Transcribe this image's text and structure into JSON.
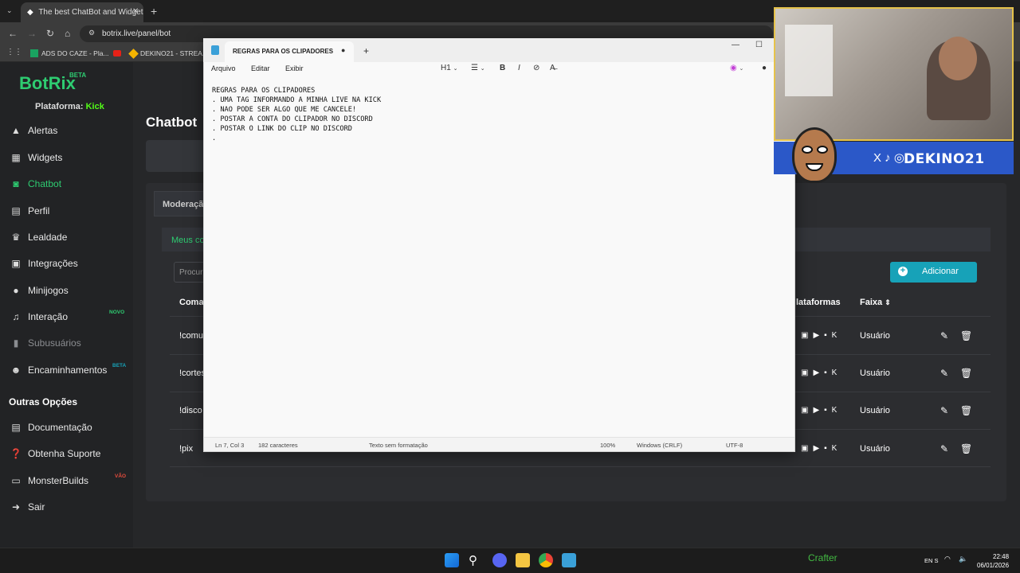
{
  "browser": {
    "tab_title": "The best ChatBot and Widgets",
    "url": "botrix.live/panel/bot",
    "bookmarks": [
      "ADS DO CAZE - Pla...",
      "DEKINO21 - STREA..."
    ]
  },
  "site": {
    "logo": "BotRix",
    "logo_badge": "BETA",
    "platform_label": "Plataforma:",
    "platform_value": "Kick",
    "nav": [
      {
        "label": "Alertas",
        "icon": "alert-icon"
      },
      {
        "label": "Widgets",
        "icon": "grid-icon"
      },
      {
        "label": "Chatbot",
        "icon": "robot-icon"
      },
      {
        "label": "Perfil",
        "icon": "id-card-icon"
      },
      {
        "label": "Lealdade",
        "icon": "trophy-icon"
      },
      {
        "label": "Integrações",
        "icon": "integration-icon"
      },
      {
        "label": "Minijogos",
        "icon": "gamepad-icon"
      },
      {
        "label": "Interação",
        "icon": "music-icon",
        "badge": "NOVO"
      },
      {
        "label": "Subusuários",
        "icon": "lock-icon"
      },
      {
        "label": "Encaminhamentos",
        "icon": "users-icon",
        "badge": "BETA"
      }
    ],
    "other_heading": "Outras Opções",
    "other_nav": [
      {
        "label": "Documentação",
        "icon": "book-icon"
      },
      {
        "label": "Obtenha Suporte",
        "icon": "help-icon"
      },
      {
        "label": "MonsterBuilds",
        "icon": "laptop-icon",
        "badge": "VÃO"
      },
      {
        "label": "Sair",
        "icon": "logout-icon"
      }
    ],
    "page_title": "Chatbot",
    "tab_moderacao": "Moderaçã",
    "subtab": "Meus co",
    "search_placeholder": "Procur",
    "add_button": "Adicionar",
    "columns": {
      "command": "Comar",
      "platforms": "lataformas",
      "tier": "Faixa"
    },
    "rows": [
      {
        "command": "!comu",
        "tier": "Usuário"
      },
      {
        "command": "!cortes",
        "tier": "Usuário"
      },
      {
        "command": "!disco",
        "tier": "Usuário"
      },
      {
        "command": "!pix",
        "tier": "Usuário"
      }
    ]
  },
  "notepad": {
    "tab_title": "REGRAS PARA OS CLIPADORES",
    "menu": [
      "Arquivo",
      "Editar",
      "Exibir"
    ],
    "heading_select": "H1",
    "lines": [
      "REGRAS PARA OS CLIPADORES",
      "",
      ". UMA TAG INFORMANDO A MINHA LIVE NA KICK",
      ". NAO PODE SER ALGO QUE ME CANCELE!",
      ". POSTAR A CONTA DO CLIPADOR NO DISCORD",
      ". POSTAR O LINK DO CLIP NO DISCORD",
      "."
    ],
    "status": {
      "position": "Ln 7, Col 3",
      "chars": "182 caracteres",
      "format": "Texto sem formatação",
      "zoom": "100%",
      "line_ending": "Windows (CRLF)",
      "encoding": "UTF-8"
    }
  },
  "overlay": {
    "channel_name": "DEKINO21",
    "social": "X ♪ ◎"
  },
  "taskbar": {
    "tray_text": "Crafter",
    "lang": "EN S",
    "time": "22:48",
    "date": "06/01/2026"
  }
}
